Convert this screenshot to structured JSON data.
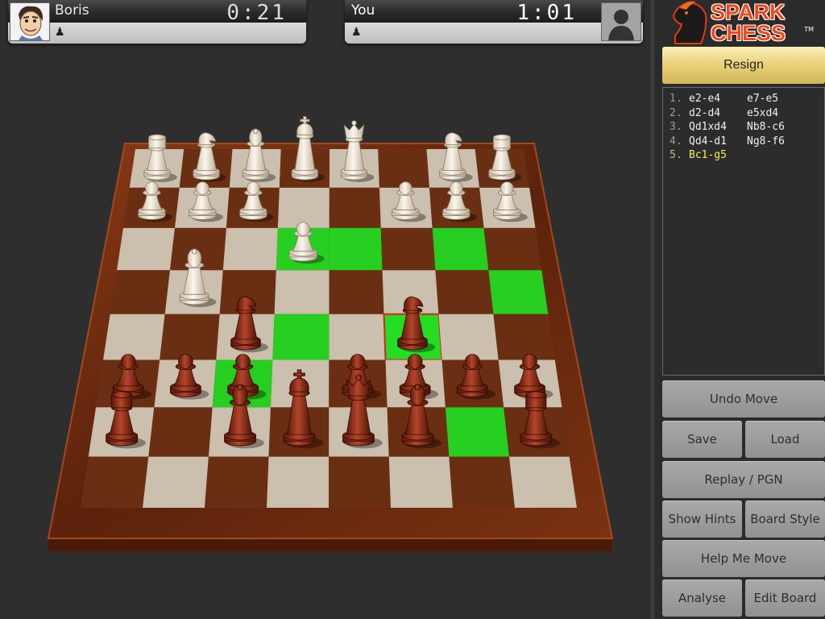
{
  "players": {
    "opponent": {
      "name": "Boris",
      "clock": "0:21",
      "side_icon": "♟"
    },
    "you": {
      "name": "You",
      "clock": "1:01",
      "side_icon": "♟"
    }
  },
  "logo": {
    "line1": "SPARK",
    "line2": "CHESS",
    "tm": "TM"
  },
  "sidebar": {
    "resign_label": "Resign",
    "buttons": {
      "undo": "Undo Move",
      "save": "Save",
      "load": "Load",
      "replay": "Replay / PGN",
      "hints": "Show Hints",
      "board_style": "Board Style",
      "help": "Help Me Move",
      "analyse": "Analyse",
      "edit_board": "Edit Board"
    }
  },
  "moves": [
    {
      "num": "1.",
      "white": "e2-e4",
      "black": "e7-e5"
    },
    {
      "num": "2.",
      "white": "d2-d4",
      "black": "e5xd4"
    },
    {
      "num": "3.",
      "white": "Qd1xd4",
      "black": "Nb8-c6"
    },
    {
      "num": "4.",
      "white": "Qd4-d1",
      "black": "Ng8-f6"
    },
    {
      "num": "5.",
      "white": "Bc1-g5",
      "black": ""
    }
  ],
  "colors": {
    "light_square": "#cbbfae",
    "dark_square": "#6a2f12",
    "highlight": "#22dd22",
    "selected_outline": "#e02020",
    "white_piece": "#efe6d6",
    "dark_piece": "#8a2a14",
    "resign_gold": "#e8d078"
  },
  "board": {
    "highlights": [
      "c3",
      "d4",
      "d6",
      "e6",
      "f4",
      "g2",
      "g6",
      "h5"
    ],
    "selected": "f4",
    "pieces": [
      {
        "sq": "a8",
        "t": "R",
        "c": "w"
      },
      {
        "sq": "b8",
        "t": "N",
        "c": "w"
      },
      {
        "sq": "c8",
        "t": "B",
        "c": "w"
      },
      {
        "sq": "d8",
        "t": "K",
        "c": "w"
      },
      {
        "sq": "e8",
        "t": "Q",
        "c": "w"
      },
      {
        "sq": "g8",
        "t": "N",
        "c": "w"
      },
      {
        "sq": "h8",
        "t": "R",
        "c": "w"
      },
      {
        "sq": "a7",
        "t": "P",
        "c": "w"
      },
      {
        "sq": "b7",
        "t": "P",
        "c": "w"
      },
      {
        "sq": "c7",
        "t": "P",
        "c": "w"
      },
      {
        "sq": "f7",
        "t": "P",
        "c": "w"
      },
      {
        "sq": "g7",
        "t": "P",
        "c": "w"
      },
      {
        "sq": "h7",
        "t": "P",
        "c": "w"
      },
      {
        "sq": "d6",
        "t": "P",
        "c": "w"
      },
      {
        "sq": "b5",
        "t": "B",
        "c": "w"
      },
      {
        "sq": "c4",
        "t": "N",
        "c": "b"
      },
      {
        "sq": "f4",
        "t": "N",
        "c": "b"
      },
      {
        "sq": "a3",
        "t": "P",
        "c": "b"
      },
      {
        "sq": "b3",
        "t": "P",
        "c": "b"
      },
      {
        "sq": "c3",
        "t": "P",
        "c": "b"
      },
      {
        "sq": "e3",
        "t": "P",
        "c": "b"
      },
      {
        "sq": "f3",
        "t": "P",
        "c": "b"
      },
      {
        "sq": "g3",
        "t": "P",
        "c": "b"
      },
      {
        "sq": "h3",
        "t": "P",
        "c": "b"
      },
      {
        "sq": "a2",
        "t": "R",
        "c": "b"
      },
      {
        "sq": "c2",
        "t": "B",
        "c": "b"
      },
      {
        "sq": "d2",
        "t": "K",
        "c": "b"
      },
      {
        "sq": "e2",
        "t": "Q",
        "c": "b"
      },
      {
        "sq": "f2",
        "t": "B",
        "c": "b"
      },
      {
        "sq": "h2",
        "t": "R",
        "c": "b"
      }
    ]
  }
}
